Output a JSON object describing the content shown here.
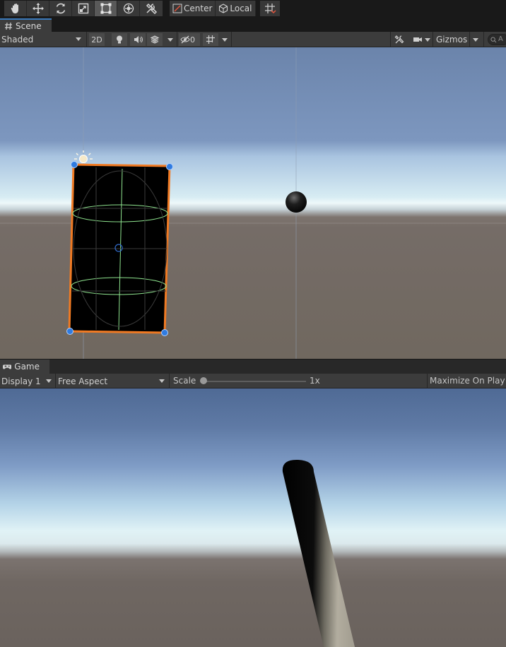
{
  "toolbar": {
    "tools": [
      "hand-tool",
      "move-tool",
      "rotate-tool",
      "scale-tool",
      "rect-tool",
      "transform-tool",
      "custom-tool"
    ],
    "active_tool": "rect-tool",
    "pivot_label": "Center",
    "space_label": "Local"
  },
  "scene": {
    "tab_label": "Scene",
    "draw_mode": "Shaded",
    "toggle_2d": "2D",
    "hidden_count": "0",
    "gizmos_label": "Gizmos",
    "search_placeholder": "A"
  },
  "game": {
    "tab_label": "Game",
    "display": "Display 1",
    "aspect": "Free Aspect",
    "scale_label": "Scale",
    "scale_value": "1x",
    "scale_slider": 0.0,
    "maximize_label": "Maximize On Play"
  },
  "colors": {
    "panel": "#3c3c3c",
    "toolbar_bg": "#191919",
    "tab_accent": "#3a79bb",
    "selection": "#f07a23",
    "handle": "#2f7be0",
    "collider": "#8fe48f"
  }
}
